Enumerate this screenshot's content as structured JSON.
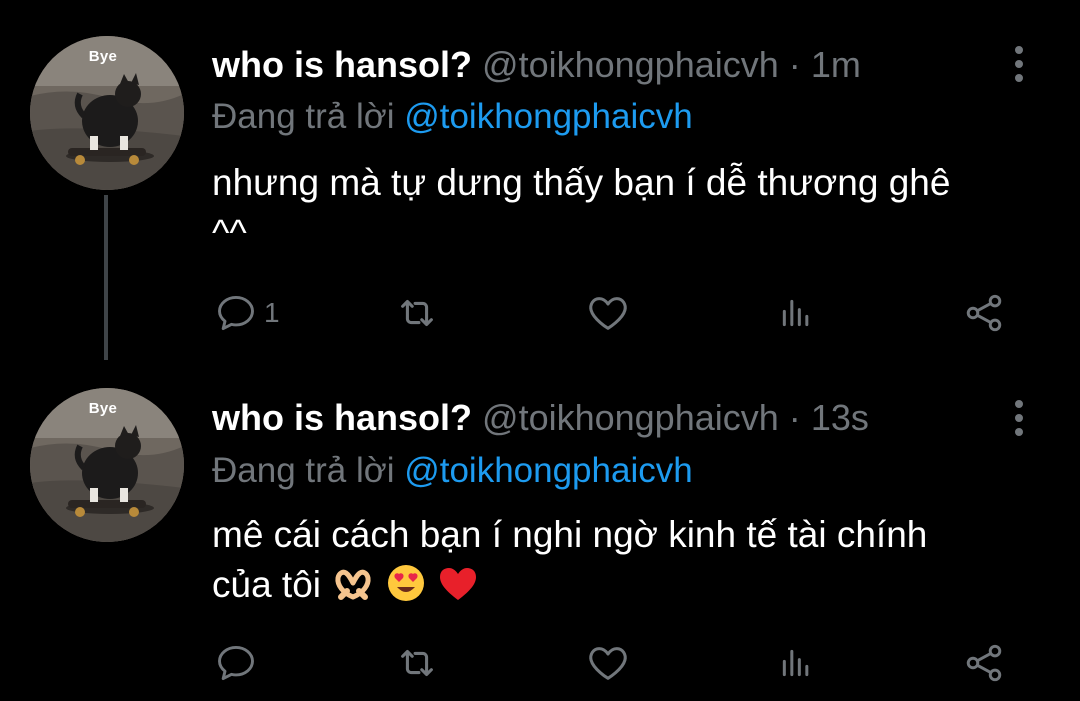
{
  "tweets": [
    {
      "avatar_caption": "Bye",
      "name": "who is hansol?",
      "handle": "@toikhongphaicvh",
      "separator": "·",
      "time": "1m",
      "replying_prefix": "Đang trả lời",
      "replying_to": "@toikhongphaicvh",
      "text_line1": "nhưng mà tự dưng thấy bạn í dễ thương ghê",
      "text_line2": "^^",
      "actions": {
        "reply_icon": "reply-icon",
        "reply_count": "1",
        "retweet_icon": "retweet-icon",
        "like_icon": "heart-icon",
        "views_icon": "analytics-icon",
        "share_icon": "share-icon"
      }
    },
    {
      "avatar_caption": "Bye",
      "name": "who is hansol?",
      "handle": "@toikhongphaicvh",
      "separator": "·",
      "time": "13s",
      "replying_prefix": "Đang trả lời",
      "replying_to": "@toikhongphaicvh",
      "text_line1": "mê cái cách bạn í nghi ngờ kinh tế tài chính",
      "text_line2": "của tôi",
      "emojis": [
        "heart-hands",
        "smiling-face-with-heart-eyes",
        "red-heart"
      ],
      "actions": {
        "reply_icon": "reply-icon",
        "reply_count": "",
        "retweet_icon": "retweet-icon",
        "like_icon": "heart-icon",
        "views_icon": "analytics-icon",
        "share_icon": "share-icon"
      }
    }
  ],
  "colors": {
    "background": "#000000",
    "text": "#ffffff",
    "muted": "#71767b",
    "link": "#1d9bf0",
    "thread_line": "#3f4448"
  }
}
